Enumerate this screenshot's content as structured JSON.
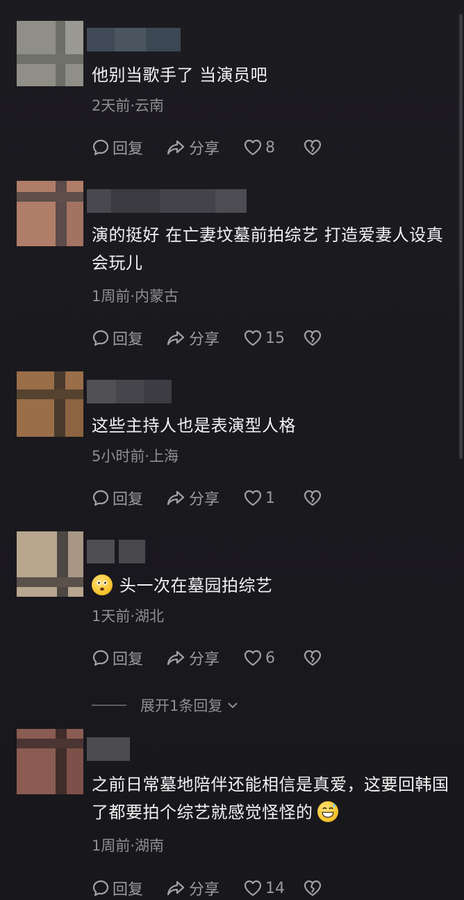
{
  "comments": [
    {
      "text": "他别当歌手了  当演员吧",
      "meta": "2天前·云南",
      "reply_label": "回复",
      "share_label": "分享",
      "likes": "8"
    },
    {
      "text": "演的挺好 在亡妻坟墓前拍综艺 打造爱妻人设真会玩儿",
      "meta": "1周前·内蒙古",
      "reply_label": "回复",
      "share_label": "分享",
      "likes": "15"
    },
    {
      "text": "这些主持人也是表演型人格",
      "meta": "5小时前·上海",
      "reply_label": "回复",
      "share_label": "分享",
      "likes": "1"
    },
    {
      "text": "头一次在墓园拍综艺",
      "meta": "1天前·湖北",
      "reply_label": "回复",
      "share_label": "分享",
      "likes": "6",
      "emoji": "flushed-face-emoji"
    },
    {
      "text": "之前日常墓地陪伴还能相信是真爱，这要回韩国了都要拍个综艺就感觉怪怪的",
      "meta": "1周前·湖南",
      "reply_label": "回复",
      "share_label": "分享",
      "likes": "14",
      "emoji": "grinning-sweat-emoji"
    }
  ],
  "expand_replies": {
    "label": "展开1条回复",
    "icon": "chevron-down-icon"
  },
  "colors": {
    "background": "#18171c",
    "text": "#f2f2f2",
    "meta": "#8e8e93",
    "action": "#9a9a9f"
  }
}
